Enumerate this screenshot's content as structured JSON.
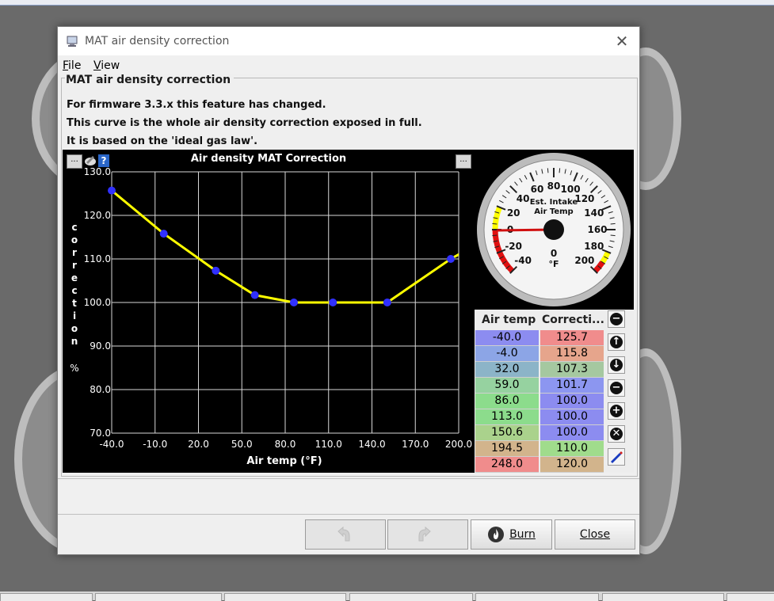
{
  "window": {
    "title": "MAT air density correction",
    "close_symbol": "✕"
  },
  "menu": {
    "file": {
      "label": "File"
    },
    "view": {
      "label": "View"
    }
  },
  "panel": {
    "title": "MAT air density correction",
    "lines": [
      "For firmware 3.3.x this feature has changed.",
      "This curve is the whole air density correction exposed in full.",
      "It is based on the 'ideal gas law'."
    ]
  },
  "chart_toolbar": {
    "dots_label": "...",
    "help_label": "?"
  },
  "chart_data": {
    "type": "line",
    "title": "Air density MAT Correction",
    "xlabel": "Air temp (°F)",
    "ylabel": "Correction",
    "ylabel_unit": "%",
    "xlim": [
      -40,
      200
    ],
    "ylim": [
      70,
      130
    ],
    "x_ticks": [
      "-40.0",
      "-10.0",
      "20.0",
      "50.0",
      "80.0",
      "110.0",
      "140.0",
      "170.0",
      "200.0"
    ],
    "y_ticks": [
      "70.0",
      "80.0",
      "90.0",
      "100.0",
      "110.0",
      "120.0",
      "130.0"
    ],
    "grid": true,
    "line_color": "#ffff00",
    "point_color": "#3030ff",
    "x": [
      -40.0,
      -4.0,
      32.0,
      59.0,
      86.0,
      113.0,
      150.6,
      194.5,
      248.0
    ],
    "y": [
      125.7,
      115.8,
      107.3,
      101.7,
      100.0,
      100.0,
      100.0,
      110.0,
      120.0
    ]
  },
  "gauge": {
    "title_line1": "Est. Intake",
    "title_line2": "Air Temp",
    "unit": "°F",
    "value": "0",
    "labels": [
      "-40",
      "-20",
      "0",
      "20",
      "40",
      "60",
      "80",
      "100",
      "120",
      "140",
      "160",
      "180",
      "200"
    ]
  },
  "table": {
    "col1_header": "Air temp",
    "col2_header": "Correcti...",
    "rows": [
      {
        "temp": "-40.0",
        "corr": "125.7",
        "tc": "#8c8cf0",
        "cc": "#f08c8c"
      },
      {
        "temp": "-4.0",
        "corr": "115.8",
        "tc": "#8ca5e6",
        "cc": "#e6a58c"
      },
      {
        "temp": "32.0",
        "corr": "107.3",
        "tc": "#8cb4c8",
        "cc": "#a5c8a0"
      },
      {
        "temp": "59.0",
        "corr": "101.7",
        "tc": "#96d2a0",
        "cc": "#8c96f0"
      },
      {
        "temp": "86.0",
        "corr": "100.0",
        "tc": "#8cdc8c",
        "cc": "#8c8cf0"
      },
      {
        "temp": "113.0",
        "corr": "100.0",
        "tc": "#8cdc8c",
        "cc": "#8c8cf0"
      },
      {
        "temp": "150.6",
        "corr": "100.0",
        "tc": "#aad28c",
        "cc": "#8c8cf0"
      },
      {
        "temp": "194.5",
        "corr": "110.0",
        "tc": "#d2b48c",
        "cc": "#a0dc8c"
      },
      {
        "temp": "248.0",
        "corr": "120.0",
        "tc": "#f08c8c",
        "cc": "#d2b48c"
      }
    ]
  },
  "side_buttons": [
    {
      "name": "collapse-button",
      "icon": "minus-circle-icon",
      "glyph": "−"
    },
    {
      "name": "move-up-button",
      "icon": "arrow-up-icon",
      "glyph": "↑"
    },
    {
      "name": "move-down-button",
      "icon": "arrow-down-icon",
      "glyph": "↓"
    },
    {
      "name": "remove-row-button",
      "icon": "minus-circle-icon",
      "glyph": "−"
    },
    {
      "name": "add-row-button",
      "icon": "plus-circle-icon",
      "glyph": "+"
    },
    {
      "name": "delete-button",
      "icon": "x-circle-icon",
      "glyph": "✕"
    },
    {
      "name": "edit-button",
      "icon": "pencil-icon",
      "glyph": ""
    }
  ],
  "buttons": {
    "burn": {
      "label": "Burn"
    },
    "close": {
      "label": "Close"
    }
  }
}
